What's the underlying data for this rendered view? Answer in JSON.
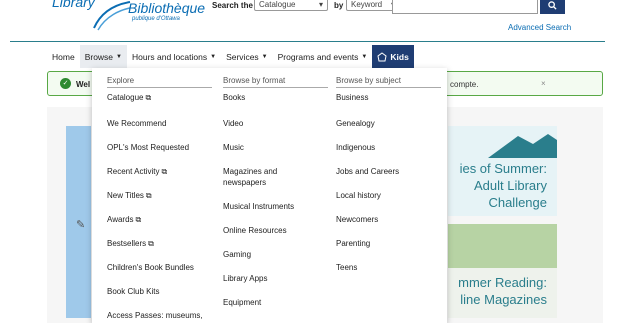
{
  "header": {
    "logo_library": "Library",
    "logo_bibliotheque": "Bibliothèque",
    "logo_sub": "publique d'Ottawa",
    "search_label": "Search the",
    "search_scope": "Catalogue",
    "by_label": "by",
    "search_field": "Keyword",
    "search_value": "",
    "advanced_search": "Advanced Search"
  },
  "nav": {
    "items": [
      {
        "label": "Home"
      },
      {
        "label": "Browse"
      },
      {
        "label": "Hours and locations"
      },
      {
        "label": "Services"
      },
      {
        "label": "Programs and events"
      },
      {
        "label": "Kids"
      }
    ]
  },
  "alert": {
    "text_start": "Wel",
    "text_end": "compte.",
    "close": "×"
  },
  "menu": {
    "col1": {
      "heading": "Explore",
      "items": [
        "Catalogue",
        "We Recommend",
        "OPL's Most Requested",
        "Recent Activity",
        "New Titles",
        "Awards",
        "Bestsellers",
        "Children's Book Bundles",
        "Book Club Kits",
        "Access Passes: museums,"
      ]
    },
    "col2": {
      "heading": "Browse by format",
      "items": [
        "Books",
        "Video",
        "Music",
        "Magazines and newspapers",
        "Musical Instruments",
        "Online Resources",
        "Gaming",
        "Library Apps",
        "Equipment"
      ]
    },
    "col3": {
      "heading": "Browse by subject",
      "items": [
        "Business",
        "Genealogy",
        "Indigenous",
        "Jobs and Careers",
        "Local history",
        "Newcomers",
        "Parenting",
        "Teens"
      ]
    }
  },
  "promos": {
    "p1_line1": "ies of Summer:",
    "p1_line2": "Adult Library",
    "p1_line3": "Challenge",
    "p2_line1": "mmer Reading:",
    "p2_line2": "line Magazines"
  },
  "colors": {
    "accent": "#1f3d73",
    "teal": "#2a7e8c",
    "success": "#58a845"
  }
}
